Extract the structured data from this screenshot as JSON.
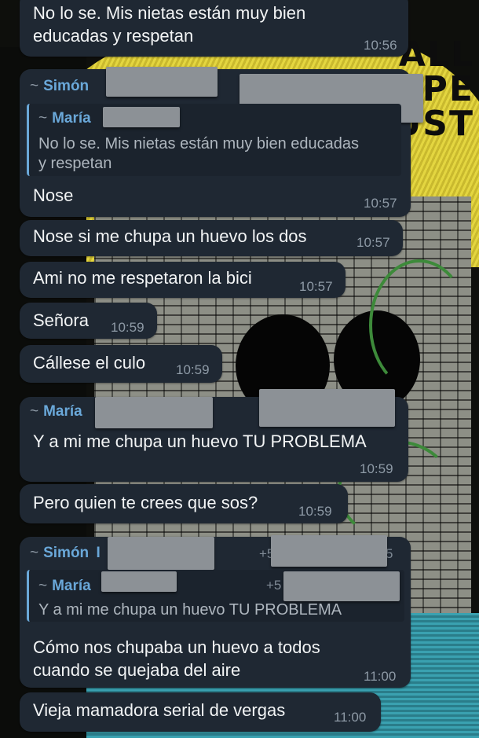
{
  "messages": [
    {
      "text_line1": "No lo se. Mis nietas están muy bien",
      "text_line2": "educadas y respetan",
      "time": "10:56"
    },
    {
      "sender": "Simón",
      "sender_prefix": "~",
      "quote": {
        "name": "María",
        "name_prefix": "~",
        "line1": "No lo se. Mis nietas están muy bien educadas",
        "line2": "y respetan"
      },
      "text": "Nose",
      "time": "10:57"
    },
    {
      "text": "Nose si me chupa un huevo los dos",
      "time": "10:57"
    },
    {
      "text": "Ami no me respetaron la bici",
      "time": "10:57"
    },
    {
      "text": "Señora",
      "time": "10:59"
    },
    {
      "text": "Cállese el culo",
      "time": "10:59"
    },
    {
      "sender": "María",
      "sender_prefix": "~",
      "text": "Y a mi me chupa un huevo TU PROBLEMA",
      "time": "10:59"
    },
    {
      "text": "Pero quien te crees que sos?",
      "time": "10:59"
    },
    {
      "sender": "Simón",
      "sender_prefix": "~",
      "sender_extra": "I",
      "phone_prefix": "+5",
      "phone_suffix": "5",
      "quote": {
        "name": "María",
        "name_prefix": "~",
        "phone_prefix": "+5",
        "line1": "Y a mi me chupa un huevo TU PROBLEMA"
      },
      "text_line1": "Cómo nos chupaba un huevo a todos",
      "text_line2": "cuando se quejaba del aire",
      "time": "11:00"
    },
    {
      "text": "Vieja mamadora serial de vergas",
      "time": "11:00"
    }
  ],
  "wallpaper": {
    "letters": [
      "ALL",
      "OPE",
      "UST"
    ],
    "colors": {
      "bubble": "#1f2833",
      "accent": "#6aa8d9",
      "time": "#8e9aa6"
    }
  }
}
